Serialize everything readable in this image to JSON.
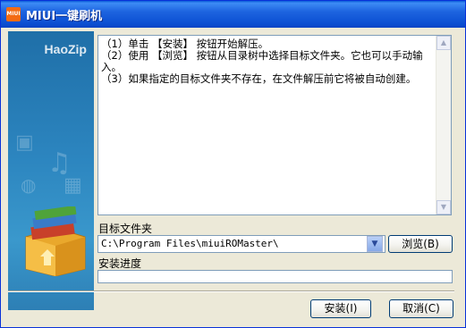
{
  "window": {
    "title": "MIUI一键刷机",
    "icon_label": "MIUI"
  },
  "left_panel": {
    "brand": "HaoZip"
  },
  "instructions": {
    "lines": [
      "（1）单击 【安装】 按钮开始解压。",
      "（2）使用 【浏览】 按钮从目录树中选择目标文件夹。它也可以手动输入。",
      "（3）如果指定的目标文件夹不存在，在文件解压前它将被自动创建。"
    ]
  },
  "target": {
    "label": "目标文件夹",
    "value": "C:\\Program Files\\miuiROMaster\\",
    "browse_label": "浏览(B)"
  },
  "progress": {
    "label": "安装进度",
    "value": 0
  },
  "buttons": {
    "install_label": "安装(I)",
    "cancel_label": "取消(C)"
  },
  "colors": {
    "title_bar": "#0a53d4",
    "window_bg": "#ece9d8",
    "panel_blue": "#2c85bf"
  }
}
